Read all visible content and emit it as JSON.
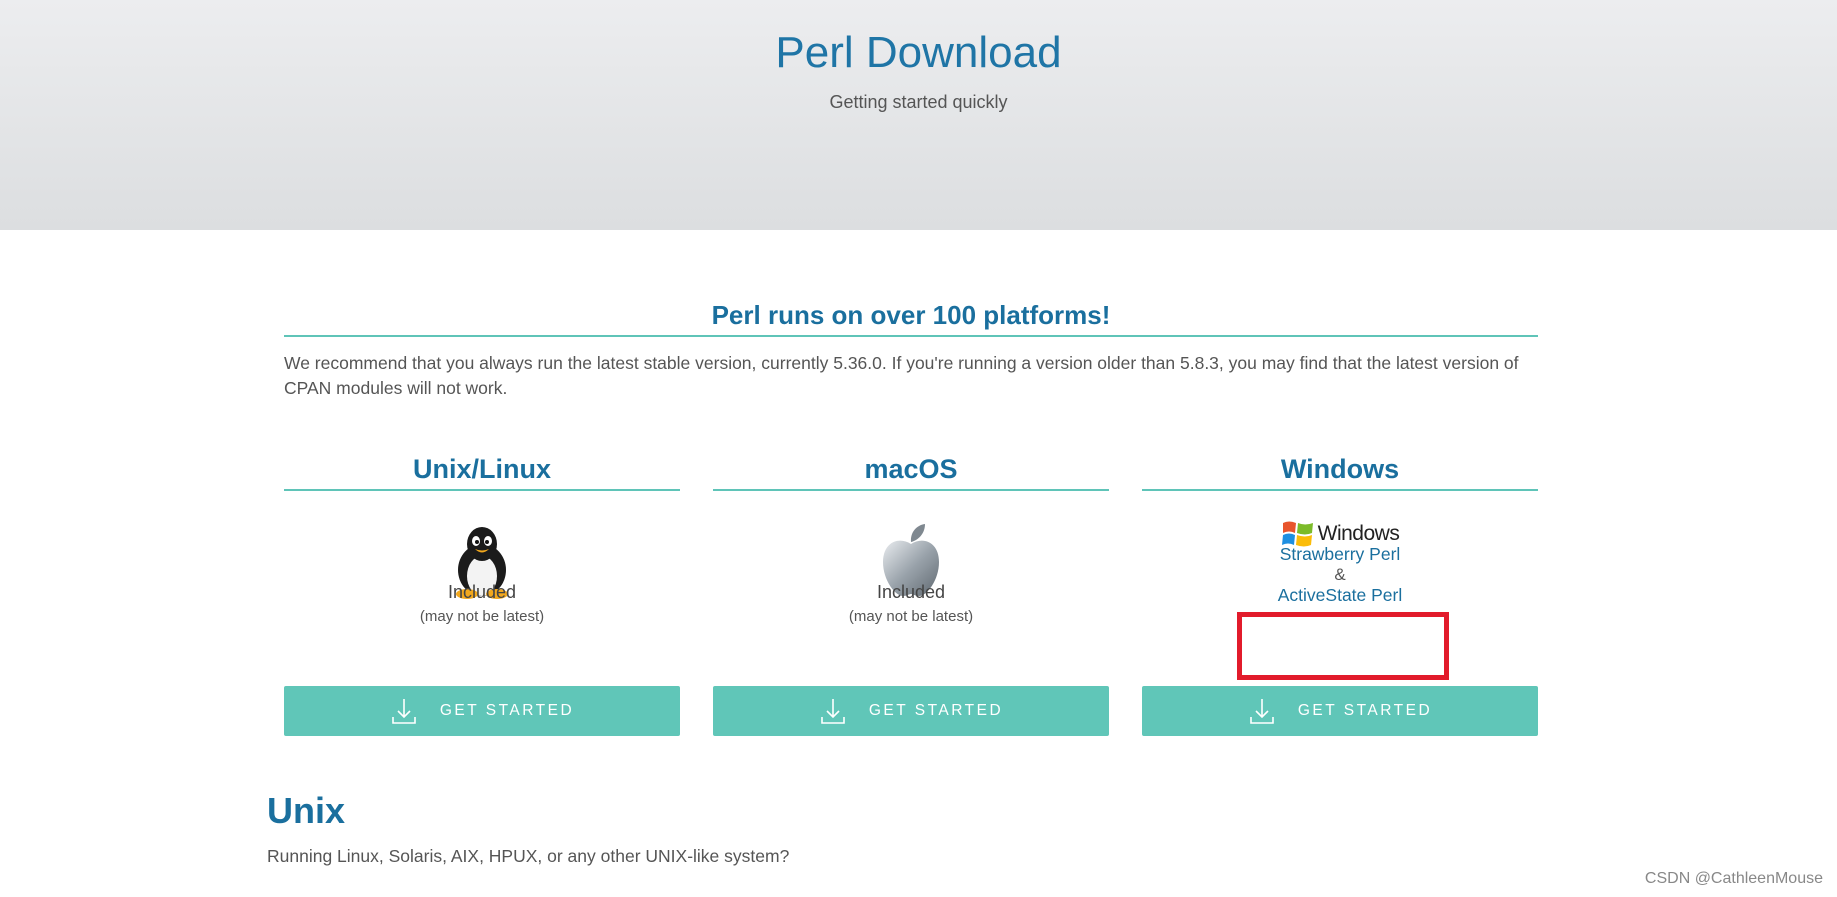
{
  "hero": {
    "title": "Perl Download",
    "subtitle": "Getting started quickly"
  },
  "platforms": {
    "title": "Perl runs on over 100 platforms!",
    "intro": "We recommend that you always run the latest stable version, currently 5.36.0. If you're running a version older than 5.8.3, you may find that the latest version of CPAN modules will not work."
  },
  "columns": [
    {
      "heading": "Unix/Linux",
      "icon": "tux-penguin-icon",
      "status": "Included",
      "note": "(may not be latest)",
      "button": "GET STARTED"
    },
    {
      "heading": "macOS",
      "icon": "apple-logo-icon",
      "status": "Included",
      "note": "(may not be latest)",
      "button": "GET STARTED"
    },
    {
      "heading": "Windows",
      "icon": "windows-logo-icon",
      "logo_text": "Windows",
      "link1": "Strawberry Perl",
      "amp": "&",
      "link2": "ActiveState Perl",
      "button": "GET STARTED"
    }
  ],
  "unix": {
    "heading": "Unix",
    "text": "Running Linux, Solaris, AIX, HPUX, or any other UNIX-like system?"
  },
  "watermark": "CSDN @CathleenMouse",
  "colors": {
    "accent_teal": "#60c6b8",
    "link_blue": "#1a6f9e",
    "highlight_red": "#e21b2b"
  }
}
